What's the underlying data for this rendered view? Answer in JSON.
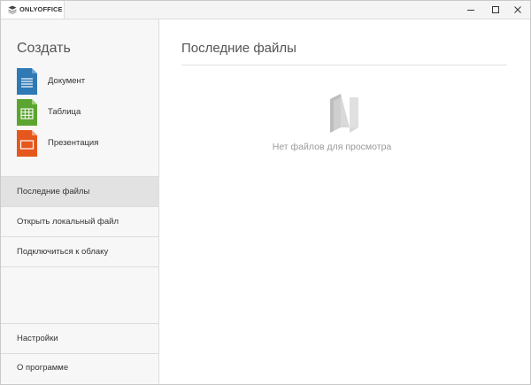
{
  "app": {
    "name": "ONLYOFFICE"
  },
  "window_controls": [
    "minimize-icon",
    "maximize-icon",
    "close-icon"
  ],
  "sidebar": {
    "create_title": "Создать",
    "create_items": [
      {
        "label": "Документ",
        "icon": "document-icon",
        "color": "#2f79b5"
      },
      {
        "label": "Таблица",
        "icon": "spreadsheet-icon",
        "color": "#5ba430"
      },
      {
        "label": "Презентация",
        "icon": "presentation-icon",
        "color": "#e5571c"
      }
    ],
    "nav": [
      {
        "label": "Последние файлы",
        "active": true
      },
      {
        "label": "Открыть локальный файл",
        "active": false
      },
      {
        "label": "Подключиться к облаку",
        "active": false
      }
    ],
    "bottom_nav": [
      {
        "label": "Настройки"
      },
      {
        "label": "О программе"
      }
    ]
  },
  "main": {
    "title": "Последние файлы",
    "empty_icon": "folder-icon",
    "empty_text": "Нет файлов для просмотра"
  }
}
